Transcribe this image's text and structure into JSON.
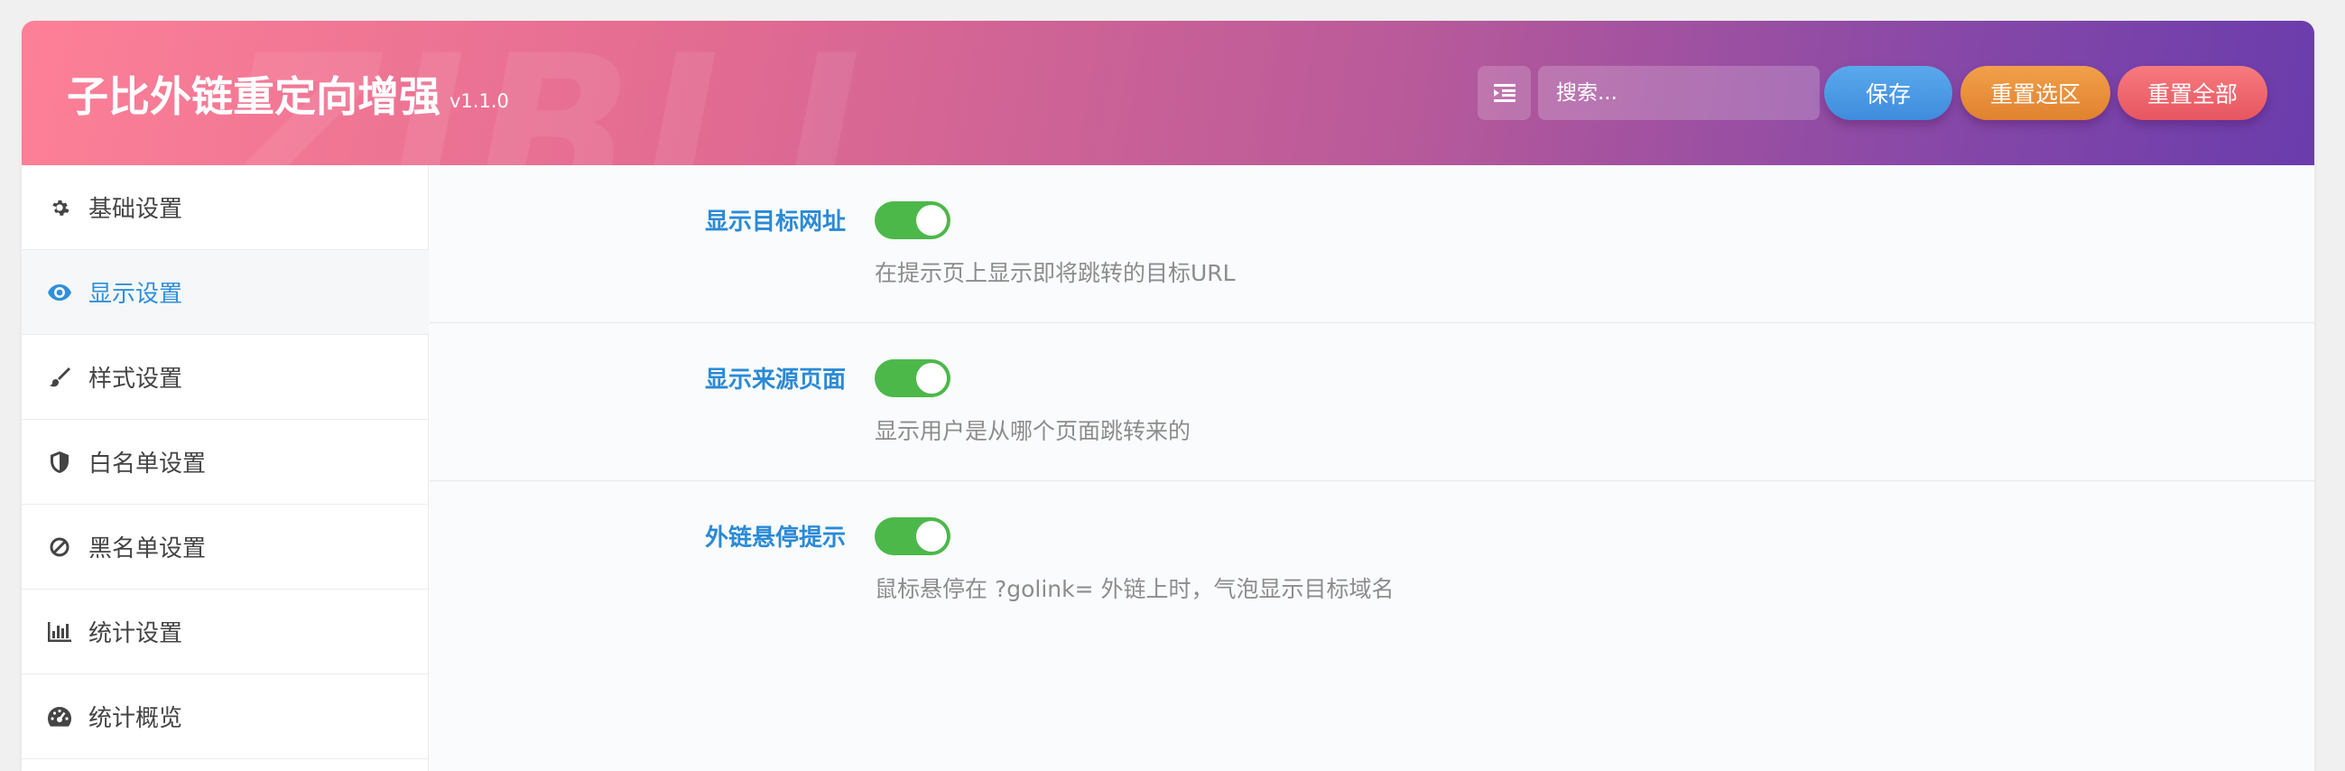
{
  "header": {
    "title": "子比外链重定向增强",
    "version": "v1.1.0",
    "watermark": "ZIBLL",
    "search_placeholder": "搜索...",
    "buttons": {
      "save": "保存",
      "reset_section": "重置选区",
      "reset_all": "重置全部"
    }
  },
  "sidebar": {
    "active_index": 1,
    "items": [
      {
        "label": "基础设置",
        "icon": "gear-icon"
      },
      {
        "label": "显示设置",
        "icon": "eye-icon"
      },
      {
        "label": "样式设置",
        "icon": "brush-icon"
      },
      {
        "label": "白名单设置",
        "icon": "shield-icon"
      },
      {
        "label": "黑名单设置",
        "icon": "ban-icon"
      },
      {
        "label": "统计设置",
        "icon": "bar-chart-icon"
      },
      {
        "label": "统计概览",
        "icon": "dashboard-icon"
      }
    ]
  },
  "settings": [
    {
      "label": "显示目标网址",
      "enabled": true,
      "description": "在提示页上显示即将跳转的目标URL"
    },
    {
      "label": "显示来源页面",
      "enabled": true,
      "description": "显示用户是从哪个页面跳转来的"
    },
    {
      "label": "外链悬停提示",
      "enabled": true,
      "description": "鼠标悬停在 ?golink= 外链上时，气泡显示目标域名"
    }
  ],
  "colors": {
    "accent": "#2f8fdc",
    "toggle_on": "#4cb84a",
    "header_gradient_start": "#fd8097",
    "header_gradient_end": "#6a3cac"
  }
}
